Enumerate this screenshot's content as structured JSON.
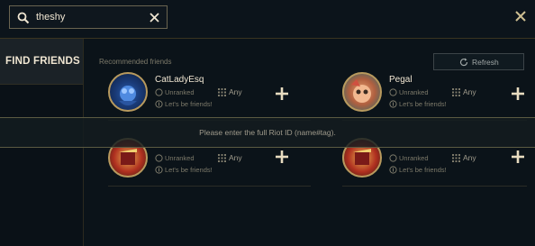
{
  "search": {
    "value": "theshy"
  },
  "sidebar": {
    "active_label": "FIND FRIENDS"
  },
  "main": {
    "section_label": "Recommended friends",
    "refresh_label": "Refresh"
  },
  "friends": [
    {
      "name": "CatLadyEsq",
      "rank": "Unranked",
      "position": "Any",
      "message": "Let's be friends!"
    },
    {
      "name": "Pegal",
      "rank": "Unranked",
      "position": "Any",
      "message": "Let's be friends!"
    },
    {
      "name": "",
      "rank": "Unranked",
      "position": "Any",
      "message": "Let's be friends!"
    },
    {
      "name": "",
      "rank": "Unranked",
      "position": "Any",
      "message": "Let's be friends!"
    }
  ],
  "banner": {
    "text": "Please enter the full Riot ID (name#tag)."
  },
  "icons": {
    "search": "search-icon",
    "clear": "clear-icon",
    "close": "close-icon",
    "refresh": "refresh-icon",
    "add": "add-friend-icon"
  },
  "colors": {
    "accent": "#c8aa6e",
    "text_light": "#f0e6d2",
    "text_dim": "#7d7a6a",
    "bg": "#0b1319"
  }
}
